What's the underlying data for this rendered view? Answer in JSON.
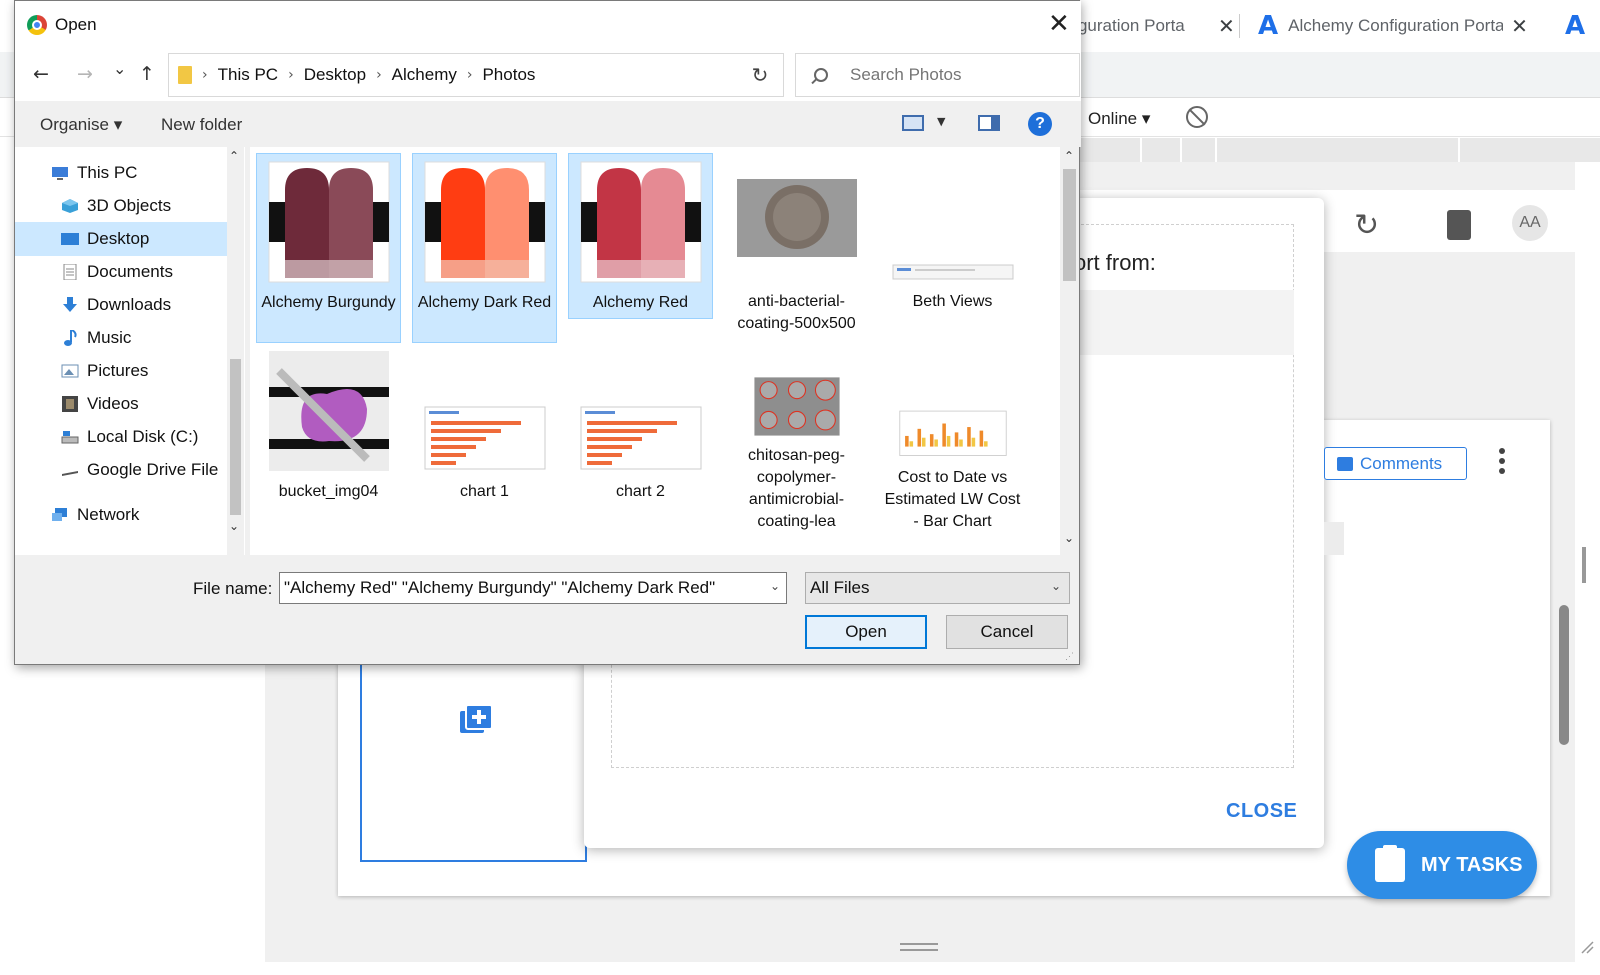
{
  "browser": {
    "tabs": [
      {
        "label": "nfiguration Porta",
        "close": "✕"
      },
      {
        "label": "Alchemy Configuration Porta",
        "close": "✕"
      }
    ],
    "toolbar": {
      "online_label": "Online ▾"
    }
  },
  "app": {
    "avatar_initials": "AA",
    "modal_title": "ort from:",
    "close_label": "CLOSE",
    "comments_label": "Comments",
    "my_tasks_label": "MY TASKS"
  },
  "dialog": {
    "title": "Open",
    "close_glyph": "✕",
    "nav": {
      "back": "←",
      "forward": "→",
      "recent": "⌄",
      "up": "↑"
    },
    "breadcrumb": [
      "This PC",
      "Desktop",
      "Alchemy",
      "Photos"
    ],
    "search_placeholder": "Search Photos",
    "commands": {
      "organise": "Organise ▾",
      "new_folder": "New folder"
    },
    "tree": [
      {
        "label": "This PC",
        "icon": "pc-icon",
        "color": "#3b7dd8"
      },
      {
        "label": "3D Objects",
        "icon": "3d-objects-icon",
        "color": "#3aa0d8"
      },
      {
        "label": "Desktop",
        "icon": "desktop-icon",
        "color": "#2d7fd6",
        "selected": true
      },
      {
        "label": "Documents",
        "icon": "documents-icon",
        "color": "#8a8a8a"
      },
      {
        "label": "Downloads",
        "icon": "downloads-icon",
        "color": "#2d7fd6"
      },
      {
        "label": "Music",
        "icon": "music-icon",
        "color": "#2d7fd6"
      },
      {
        "label": "Pictures",
        "icon": "pictures-icon",
        "color": "#6b8fb3"
      },
      {
        "label": "Videos",
        "icon": "videos-icon",
        "color": "#444"
      },
      {
        "label": "Local Disk (C:)",
        "icon": "disk-icon",
        "color": "#666"
      },
      {
        "label": "Google Drive File",
        "icon": "drive-icon",
        "color": "#555"
      },
      {
        "label": "Network",
        "icon": "network-icon",
        "color": "#2d7fd6"
      }
    ],
    "files": [
      {
        "name": "Alchemy Burgundy",
        "selected": true,
        "thumb": "swatch",
        "c1": "#6e2a3a",
        "c2": "#8a4a58"
      },
      {
        "name": "Alchemy Dark Red",
        "selected": true,
        "thumb": "swatch",
        "c1": "#ff3d12",
        "c2": "#ff8f70"
      },
      {
        "name": "Alchemy Red",
        "selected": true,
        "thumb": "swatch",
        "c1": "#c23545",
        "c2": "#e58a93"
      },
      {
        "name": "anti-bacterial-coating-500x500",
        "selected": false,
        "thumb": "photo-disc"
      },
      {
        "name": "Beth Views",
        "selected": false,
        "thumb": "wide-screenshot"
      },
      {
        "name": "bucket_img04",
        "selected": false,
        "thumb": "photo-bucket"
      },
      {
        "name": "chart 1",
        "selected": false,
        "thumb": "bar-screenshot"
      },
      {
        "name": "chart 2",
        "selected": false,
        "thumb": "bar-screenshot"
      },
      {
        "name": "chitosan-peg-copolymer-antimicrobial-coating-lea",
        "selected": false,
        "thumb": "photo-circles"
      },
      {
        "name": "Cost to Date vs Estimated LW Cost - Bar Chart",
        "selected": false,
        "thumb": "column-chart"
      }
    ],
    "file_name_label": "File name:",
    "file_name_value": "\"Alchemy Red\" \"Alchemy Burgundy\" \"Alchemy Dark Red\"",
    "file_type": "All Files",
    "open_label": "Open",
    "cancel_label": "Cancel"
  }
}
